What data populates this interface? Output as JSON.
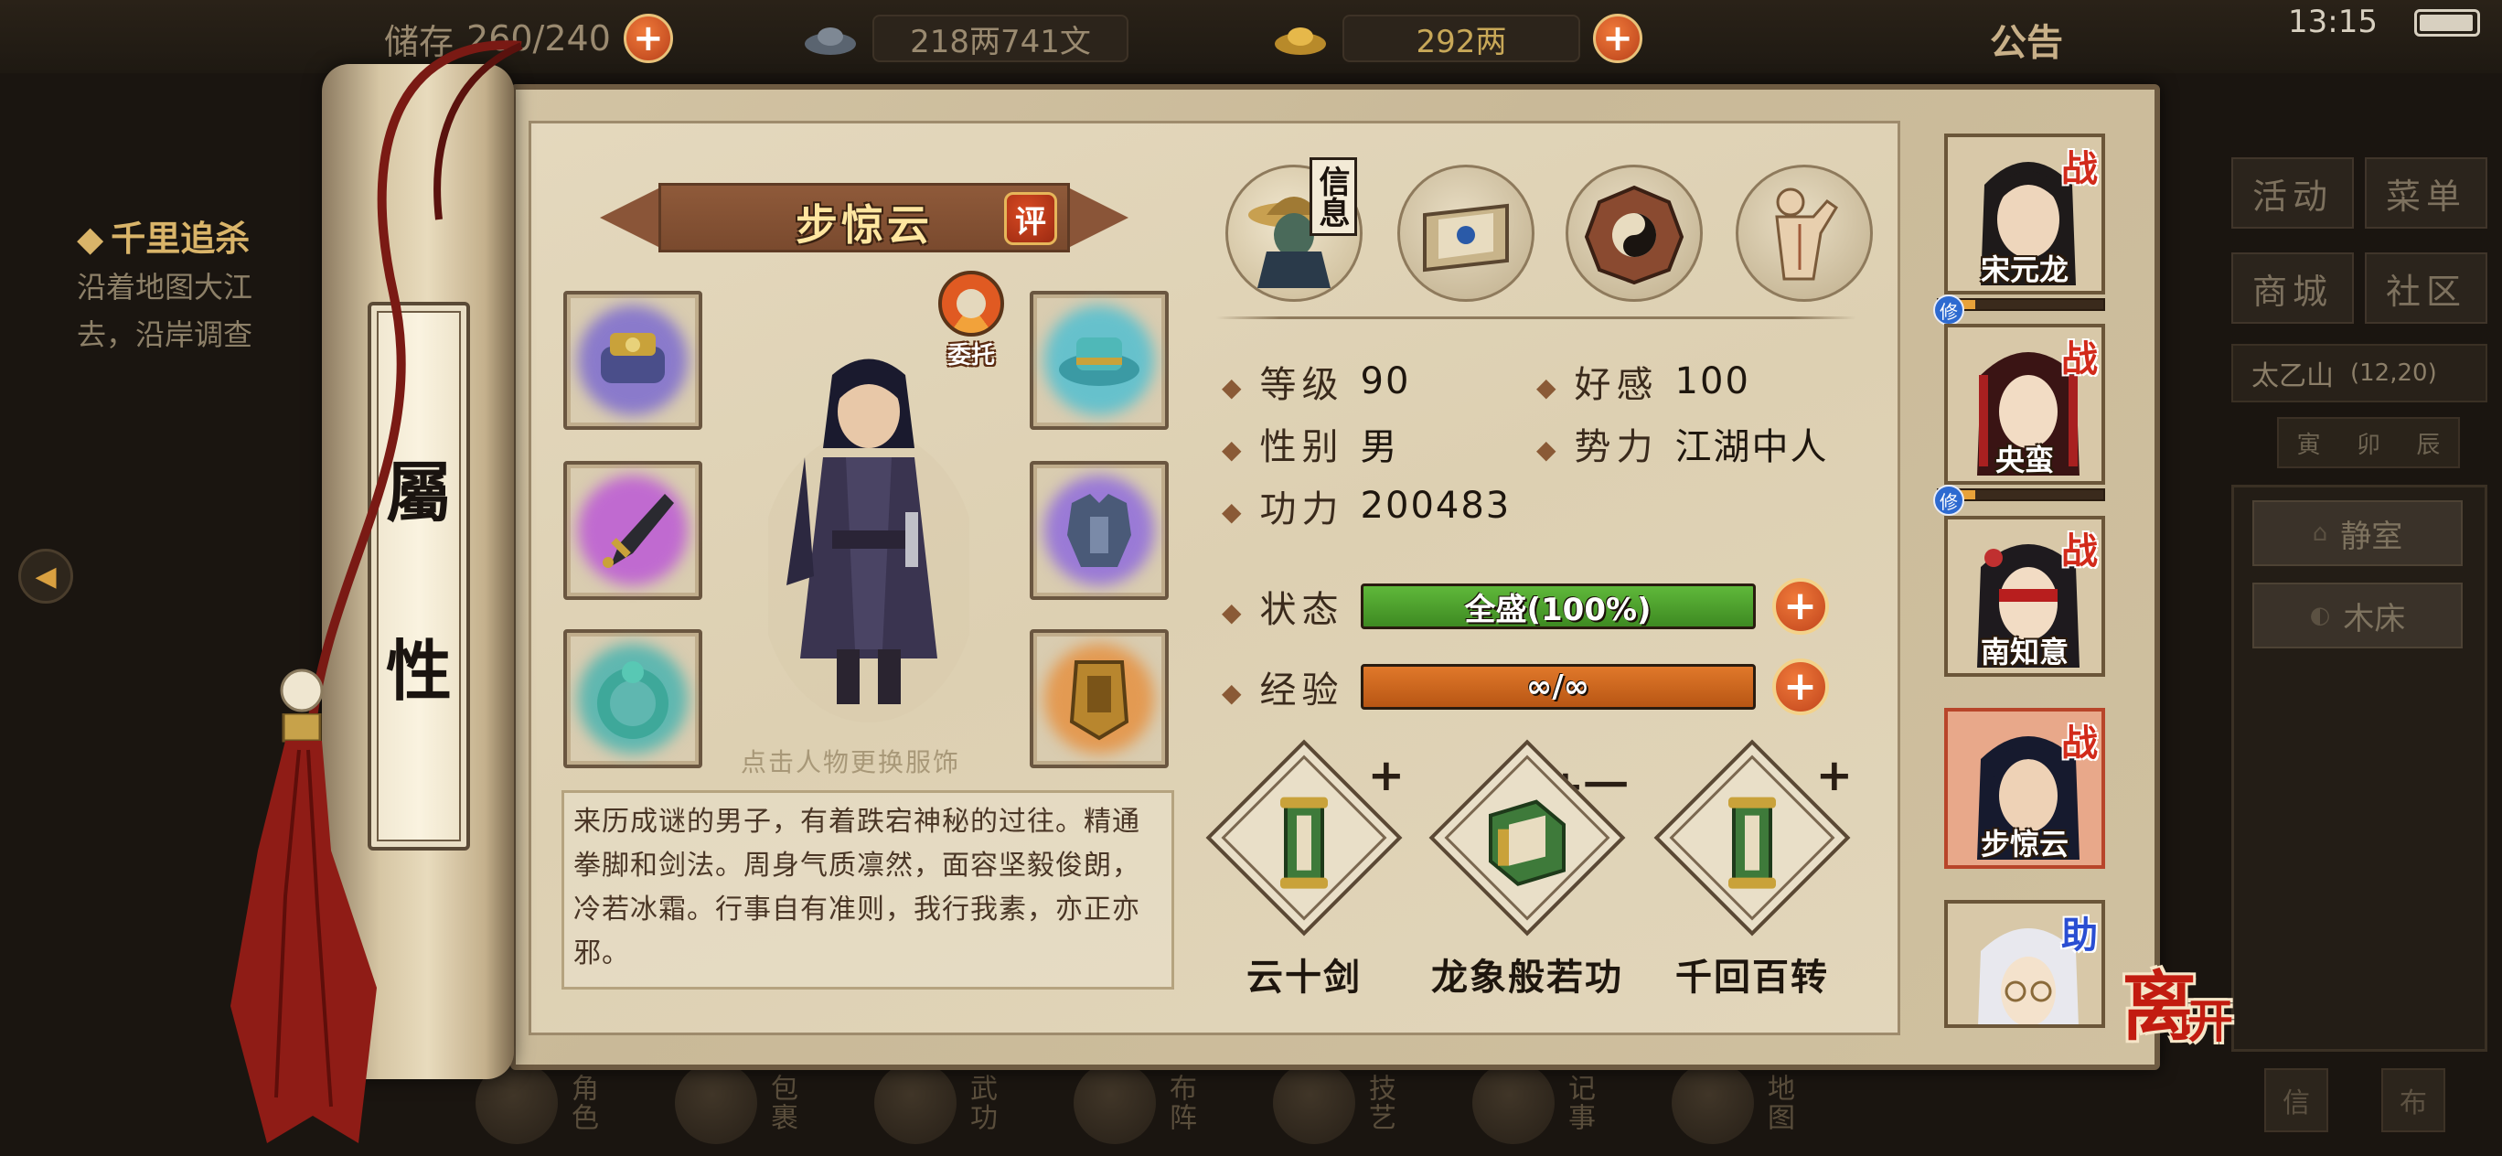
{
  "top_bar": {
    "storage_label": "储存",
    "storage_value": "260/240",
    "copper": "218两741文",
    "gold": "292两",
    "notice": "公告",
    "clock": "13:15"
  },
  "quest": {
    "title": "千里追杀",
    "text_line1": "沿着地图大江",
    "text_line2": "去，沿岸调查"
  },
  "right_menu": {
    "buttons": [
      "活动",
      "菜单",
      "商城",
      "社区"
    ],
    "location": "太乙山",
    "coords": "(12,20)",
    "time_ticks": [
      "寅",
      "卯",
      "辰"
    ],
    "rooms": [
      "静室",
      "木床"
    ]
  },
  "bottom_nav": [
    "角色",
    "包裹",
    "武功",
    "布阵",
    "技艺",
    "记事",
    "地图"
  ],
  "bottom_right_buttons": [
    "信",
    "布"
  ],
  "scroll_title_chars": [
    "屬",
    "性"
  ],
  "hero": {
    "name": "步惊云",
    "rate_badge": "评",
    "entrust_label": "委托",
    "outfit_hint": "点击人物更换服饰",
    "description": "来历成谜的男子，有着跌宕神秘的过往。精通拳脚和剑法。周身气质凛然，面容坚毅俊朗，冷若冰霜。行事自有准则，我行我素，亦正亦邪。"
  },
  "equipment": [
    {
      "slot": "gauntlet",
      "icon": "gauntlet-icon",
      "glow": "#8a7acb"
    },
    {
      "slot": "hat",
      "icon": "hat-icon",
      "glow": "#66c1cc"
    },
    {
      "slot": "weapon",
      "icon": "dagger-icon",
      "glow": "#c06ad0"
    },
    {
      "slot": "armor",
      "icon": "armor-icon",
      "glow": "#9a7ad6"
    },
    {
      "slot": "ring",
      "icon": "jade-ring-icon",
      "glow": "#5fb7b0"
    },
    {
      "slot": "token",
      "icon": "token-icon",
      "glow": "#e39a52"
    }
  ],
  "tabs": [
    {
      "name": "info",
      "label": "信息",
      "icon": "hero-portrait-icon"
    },
    {
      "name": "book",
      "icon": "book-icon"
    },
    {
      "name": "bagua",
      "icon": "bagua-icon"
    },
    {
      "name": "meridian",
      "icon": "meridian-body-icon"
    }
  ],
  "stats": {
    "level_label": "等级",
    "level": "90",
    "favor_label": "好感",
    "favor": "100",
    "gender_label": "性别",
    "gender": "男",
    "faction_label": "势力",
    "faction": "江湖中人",
    "power_label": "功力",
    "power": "200483"
  },
  "bars": {
    "state_label": "状态",
    "state_text": "全盛(100%)",
    "state_fraction": 1.0,
    "state_color": "#5fb83a",
    "exp_label": "经验",
    "exp_text": "∞/∞",
    "exp_fraction": 1.0,
    "exp_color": "#e0782a"
  },
  "skills": [
    {
      "name": "云十剑",
      "level_mark": "+",
      "icon": "scroll-icon"
    },
    {
      "name": "龙象般若功",
      "level_mark": "+一",
      "icon": "book-scroll-icon"
    },
    {
      "name": "千回百转",
      "level_mark": "+",
      "icon": "scroll-icon"
    }
  ],
  "party": [
    {
      "name": "宋元龙",
      "tag": "战",
      "cultivate": "修"
    },
    {
      "name": "央蛮",
      "tag": "战",
      "cultivate": "修"
    },
    {
      "name": "南知意",
      "tag": "战"
    },
    {
      "name": "步惊云",
      "tag": "战",
      "selected": true
    },
    {
      "name": "",
      "tag": "助"
    }
  ],
  "leave_label": "离",
  "leave_label_small": "开"
}
